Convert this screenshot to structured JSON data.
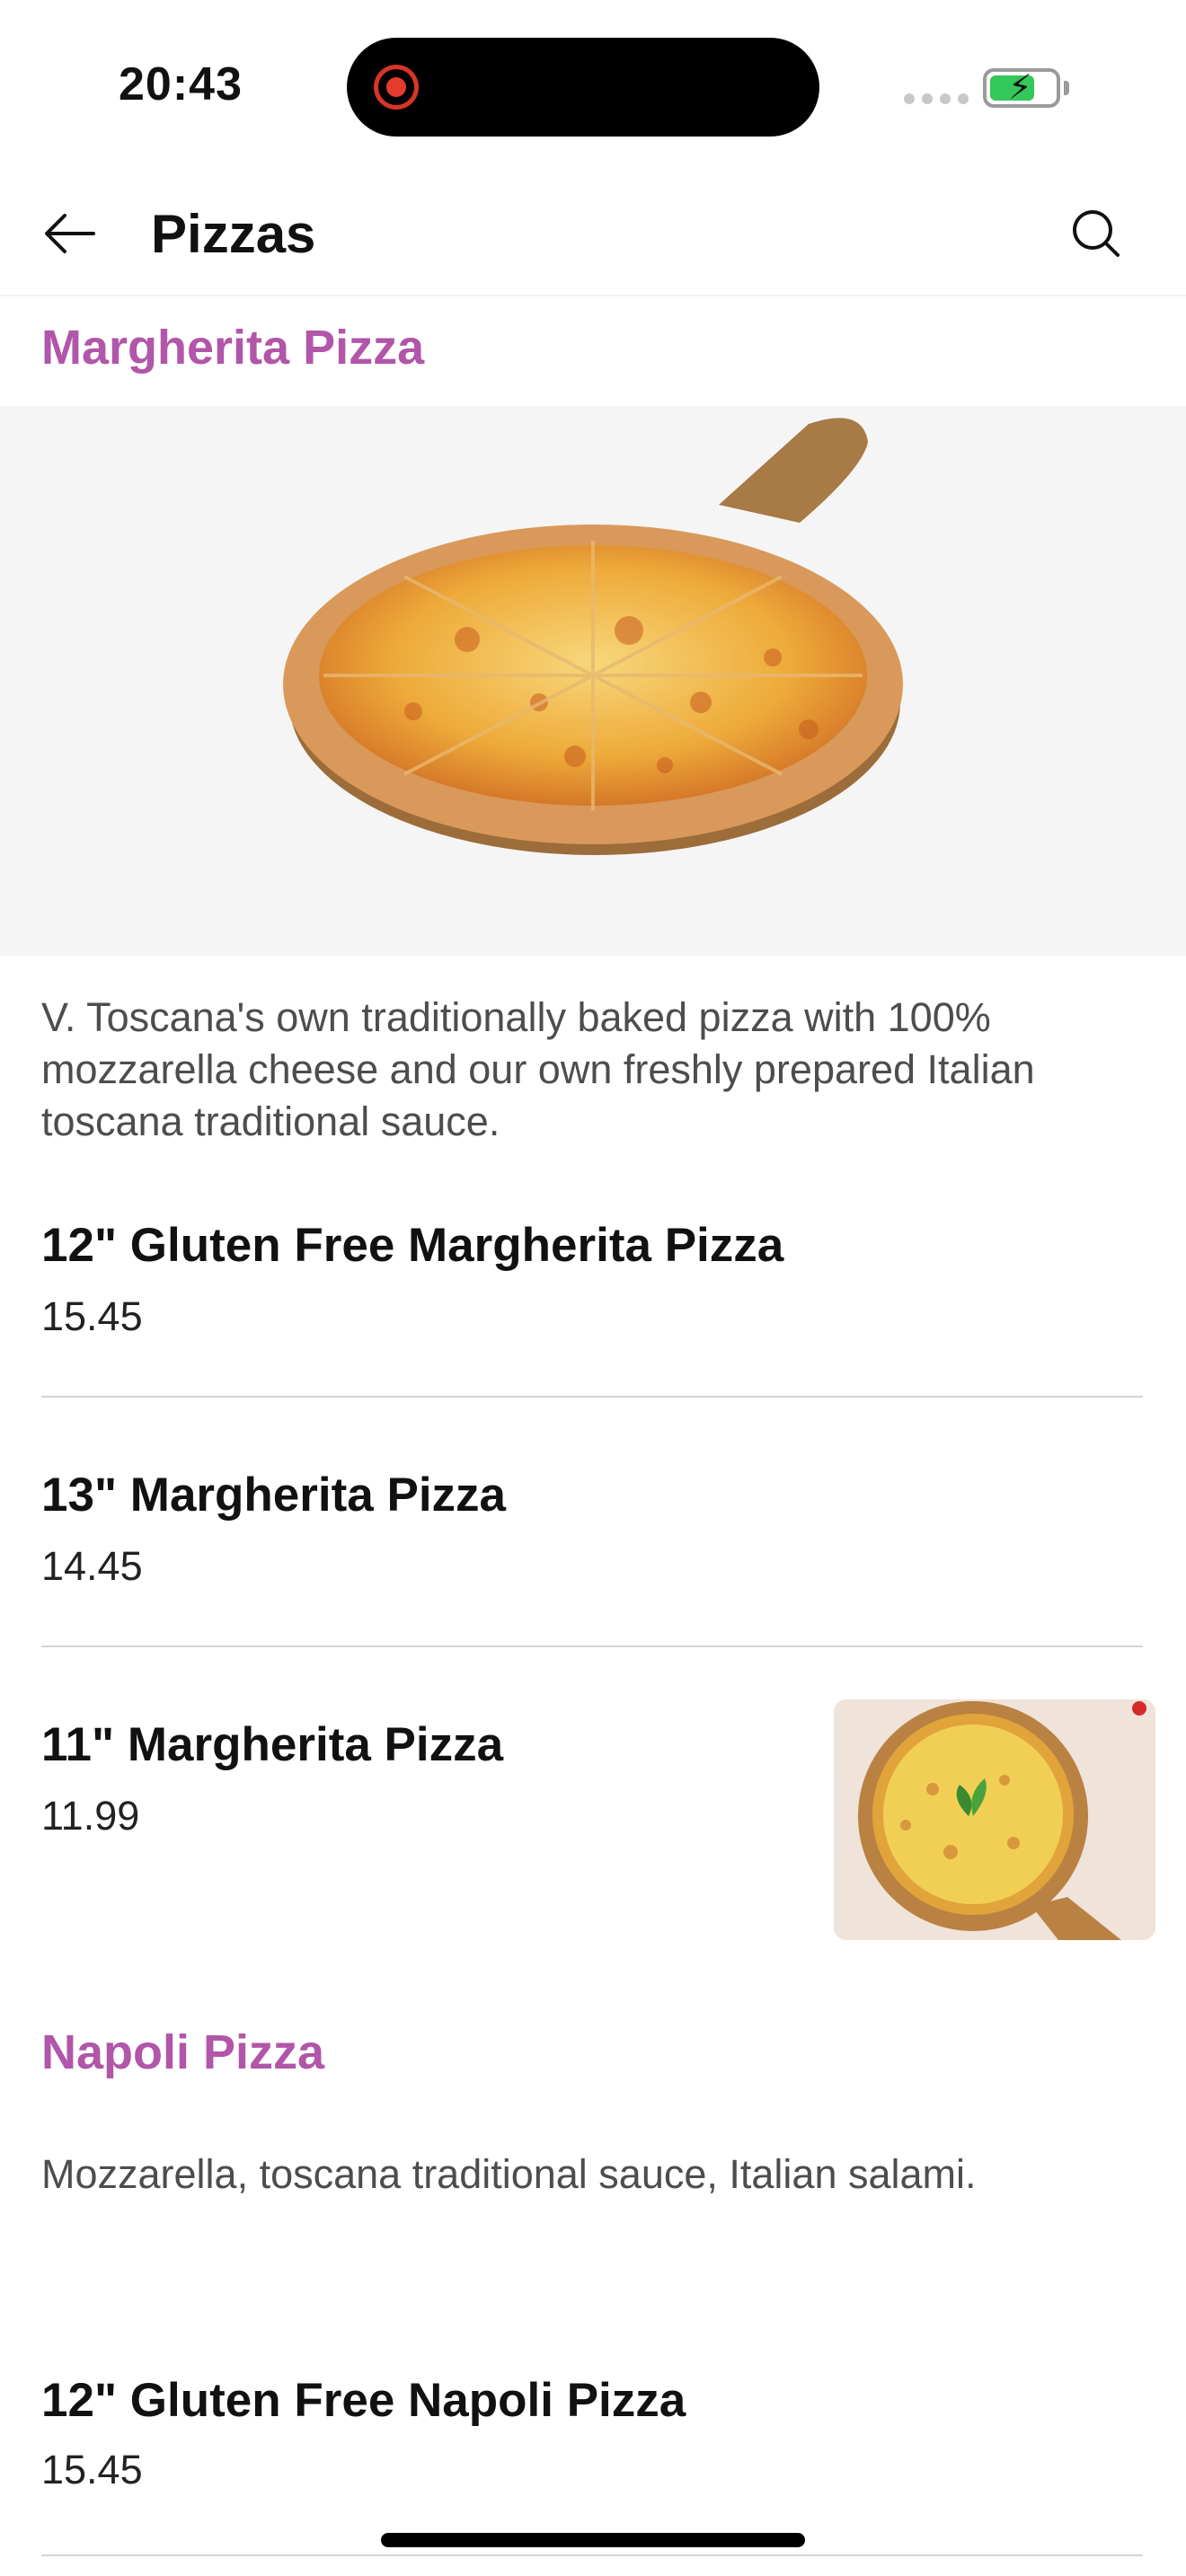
{
  "status_bar": {
    "time": "20:43"
  },
  "header": {
    "title": "Pizzas",
    "back_icon": "back-arrow-icon",
    "search_icon": "search-icon"
  },
  "sections": [
    {
      "title": "Margherita Pizza",
      "description": "V. Toscana's own traditionally baked pizza with 100% mozzarella cheese and our own freshly prepared Italian toscana traditional sauce.",
      "items": [
        {
          "name": "12\" Gluten Free Margherita Pizza",
          "price": "15.45"
        },
        {
          "name": "13\" Margherita Pizza",
          "price": "14.45"
        },
        {
          "name": "11\" Margherita Pizza",
          "price": "11.99"
        }
      ]
    },
    {
      "title": "Napoli Pizza",
      "description": "Mozzarella, toscana traditional sauce, Italian salami.",
      "items": [
        {
          "name": "12\" Gluten Free Napoli Pizza",
          "price": "15.45"
        }
      ]
    }
  ],
  "colors": {
    "accent": "#b156a9",
    "battery": "#34c759",
    "recording": "#e53b2f"
  }
}
